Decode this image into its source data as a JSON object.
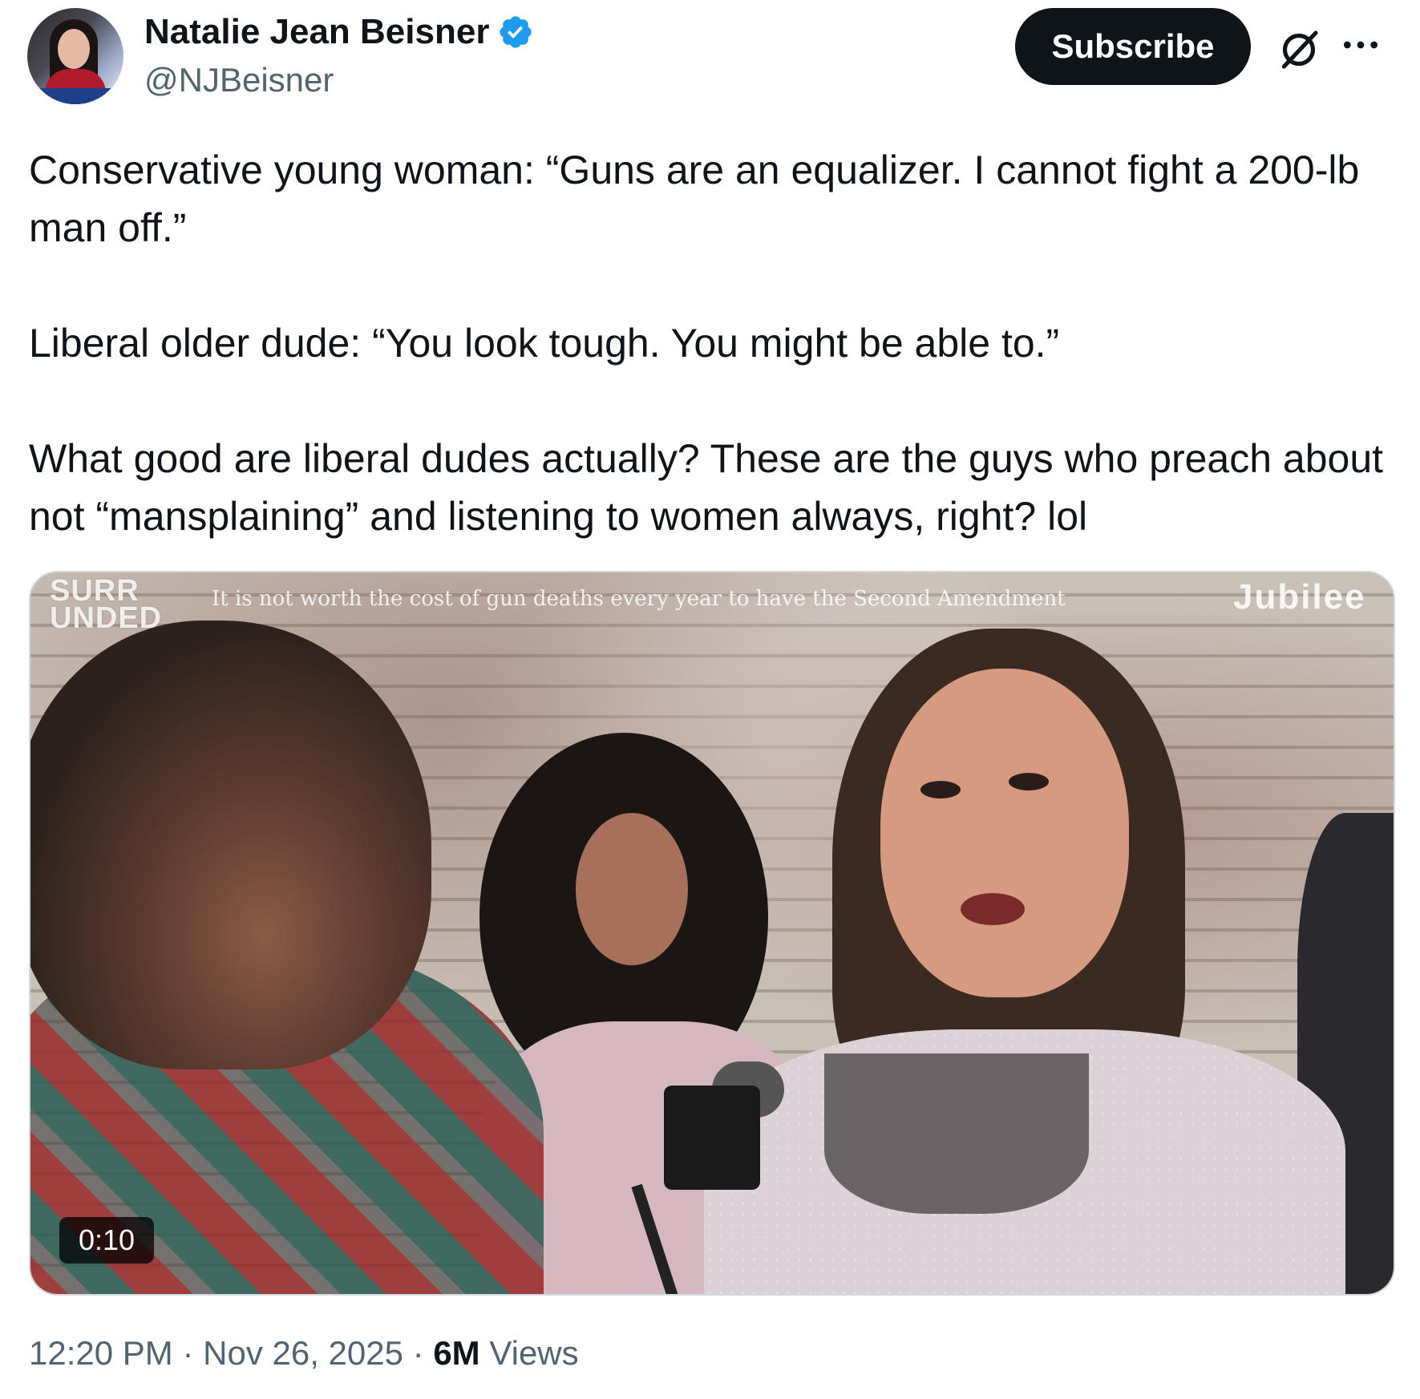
{
  "author": {
    "display_name": "Natalie Jean Beisner",
    "handle": "@NJBeisner",
    "verified_icon": "verified-badge-icon",
    "accent_color": "#1d9bf0"
  },
  "actions": {
    "subscribe_label": "Subscribe",
    "grok_icon": "grok-icon",
    "more_icon": "more-options-icon"
  },
  "tweet": {
    "paragraphs": [
      "Conservative young woman: “Guns are an equalizer. I cannot fight a 200-lb man off.”",
      "Liberal older dude: “You look tough. You might be able to.”",
      "What good are liberal dudes actually?  These are the guys who preach about not “mansplaining” and listening to women always, right? lol"
    ]
  },
  "media": {
    "overlay_logo_left_line1": "SURR",
    "overlay_logo_left_line2": "UNDED",
    "overlay_caption": "It is not worth the cost of gun deaths every year to have the Second Amendment",
    "overlay_logo_right": "Jubilee",
    "duration": "0:10"
  },
  "meta": {
    "time": "12:20 PM",
    "separator": "·",
    "date": "Nov 26, 2025",
    "views_count": "6M",
    "views_label": "Views"
  }
}
